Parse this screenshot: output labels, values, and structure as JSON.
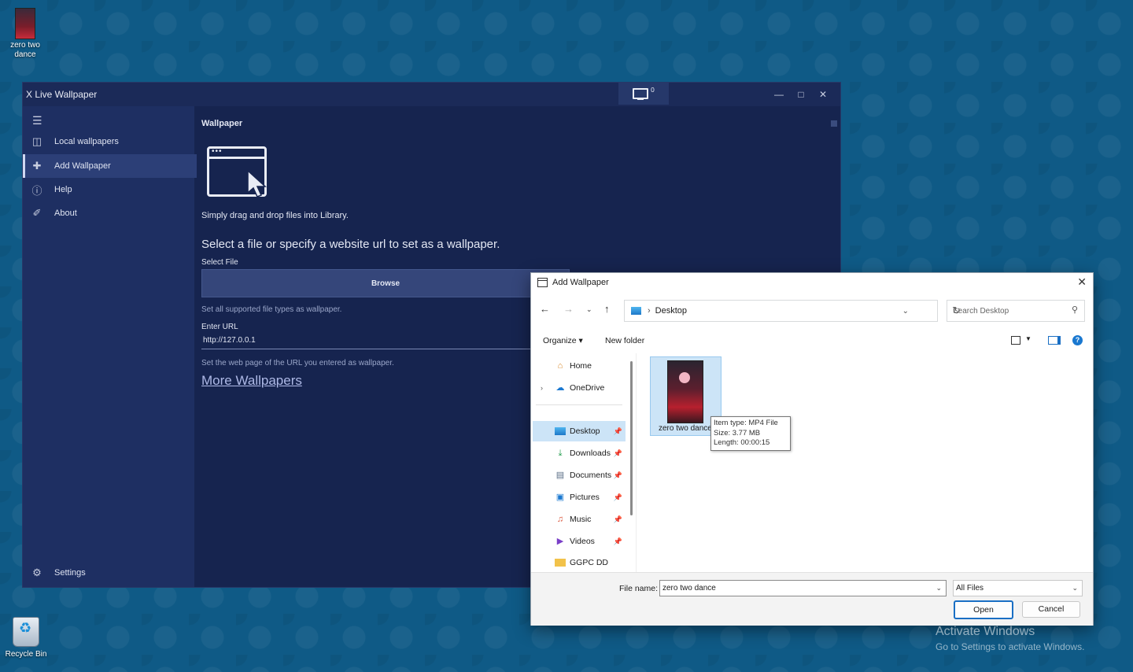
{
  "desktop": {
    "icons": [
      {
        "label": "zero two dance",
        "icon": "video-thumbnail-icon"
      },
      {
        "label": "Recycle Bin",
        "icon": "recycle-bin-icon"
      }
    ]
  },
  "app": {
    "title": "X Live Wallpaper",
    "monitor_count": "0",
    "nav": [
      {
        "label": "Local wallpapers",
        "icon": "library-icon"
      },
      {
        "label": "Add Wallpaper",
        "icon": "plus-icon",
        "active": true
      },
      {
        "label": "Help",
        "icon": "question-icon"
      },
      {
        "label": "About",
        "icon": "info-icon"
      }
    ],
    "settings_label": "Settings",
    "content": {
      "section_title": "Wallpaper",
      "drag_hint": "Simply drag and drop files into Library.",
      "headline": "Select a file or specify a website url to set as a wallpaper.",
      "select_file_label": "Select File",
      "browse_label": "Browse",
      "file_types_hint": "Set all supported file types as wallpaper.",
      "url_label": "Enter URL",
      "url_value": "http://127.0.0.1",
      "url_hint": "Set the web page of the URL you entered as wallpaper.",
      "more_link": "More Wallpapers"
    }
  },
  "dialog": {
    "title": "Add Wallpaper",
    "path": "Desktop",
    "search_placeholder": "Search Desktop",
    "organize_label": "Organize",
    "new_folder_label": "New folder",
    "tree": [
      {
        "label": "Home",
        "icon": "home-icon"
      },
      {
        "label": "OneDrive",
        "icon": "cloud-icon"
      },
      {
        "label": "Desktop",
        "icon": "desktop-icon",
        "pinned": true,
        "selected": true
      },
      {
        "label": "Downloads",
        "icon": "download-icon",
        "pinned": true
      },
      {
        "label": "Documents",
        "icon": "document-icon",
        "pinned": true
      },
      {
        "label": "Pictures",
        "icon": "picture-icon",
        "pinned": true
      },
      {
        "label": "Music",
        "icon": "music-icon",
        "pinned": true
      },
      {
        "label": "Videos",
        "icon": "video-icon",
        "pinned": true
      },
      {
        "label": "GGPC DD",
        "icon": "folder-icon"
      }
    ],
    "file": {
      "name": "zero two dance",
      "tooltip_type": "Item type: MP4 File",
      "tooltip_size": "Size: 3.77 MB",
      "tooltip_length": "Length: 00:00:15"
    },
    "file_name_label": "File name:",
    "file_name_value": "zero two dance",
    "filter_value": "All Files",
    "open_label": "Open",
    "cancel_label": "Cancel"
  },
  "watermark": {
    "line1": "Activate Windows",
    "line2": "Go to Settings to activate Windows."
  }
}
